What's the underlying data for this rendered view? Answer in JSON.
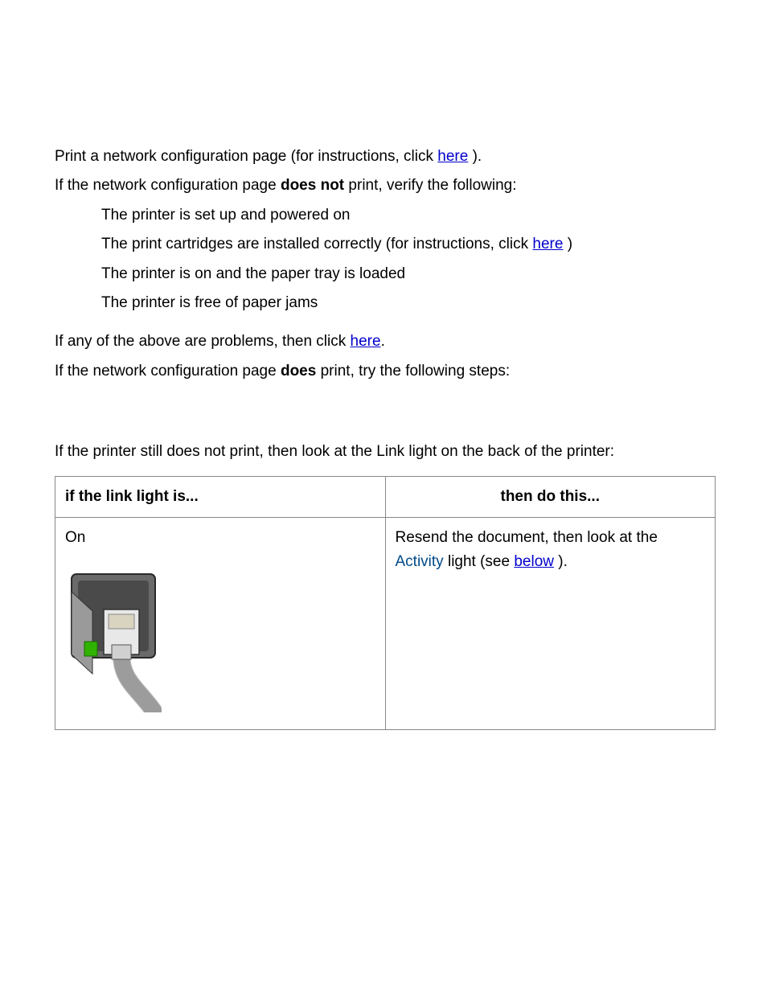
{
  "intro": {
    "line1_pre": "Print a network configuration page (for instructions, click ",
    "line1_link": "here",
    "line1_post": " ).",
    "line2_pre": "If the network configuration page ",
    "line2_strong": "does not",
    "line2_post": " print, verify the following:"
  },
  "checklist": {
    "item1": "The printer is set up and powered on",
    "item2_pre": "The print cartridges are installed correctly (for instructions, click ",
    "item2_link": "here",
    "item2_post": " )",
    "item3": "The printer is on and the paper tray is loaded",
    "item4": "The printer is free of paper jams"
  },
  "followup": {
    "line1_pre": "If any of the above are problems, then click ",
    "line1_link": "here",
    "line1_post": ".",
    "line2_pre": "If the network configuration page ",
    "line2_strong": "does",
    "line2_post": " print, try the following steps:"
  },
  "tablelead": "If the printer still does not print, then look at the Link light on the back of the printer:",
  "table": {
    "header_if": "if the link light is...",
    "header_then": "then do this...",
    "row1_status": "On",
    "row1_action_pre": "Resend the document, then look at the ",
    "row1_action_styled": "Activity",
    "row1_action_mid": " light (see ",
    "row1_action_link": "below",
    "row1_action_post": " )."
  }
}
